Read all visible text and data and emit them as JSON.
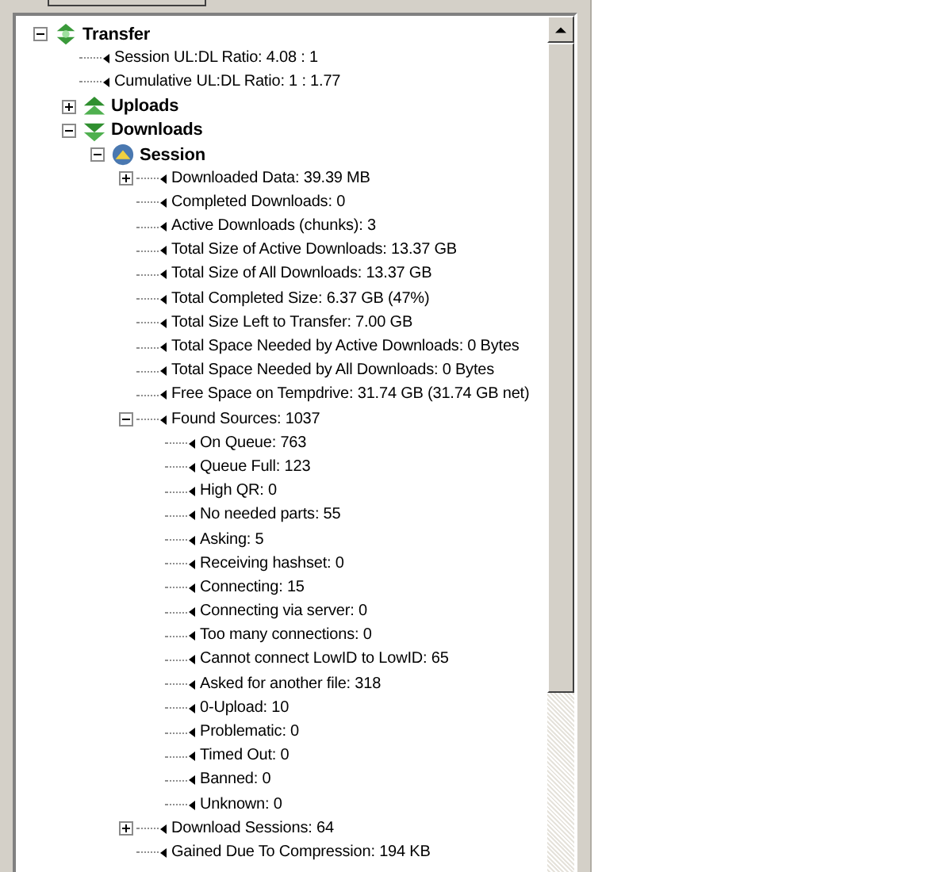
{
  "tree": [
    {
      "label": "Transfer",
      "kind": "transfer",
      "expanded": true,
      "children": [
        {
          "label": "Session UL:DL Ratio: 4.08 : 1",
          "kind": "stat"
        },
        {
          "label": "Cumulative UL:DL Ratio: 1 : 1.77",
          "kind": "stat"
        },
        {
          "label": "Uploads",
          "kind": "uploads",
          "expanded": false
        },
        {
          "label": "Downloads",
          "kind": "downloads",
          "expanded": true,
          "children": [
            {
              "label": "Session",
              "kind": "session",
              "expanded": true,
              "children": [
                {
                  "label": "Downloaded Data: 39.39 MB",
                  "kind": "stat",
                  "expanded": false
                },
                {
                  "label": "Completed Downloads: 0",
                  "kind": "stat"
                },
                {
                  "label": "Active Downloads (chunks): 3",
                  "kind": "stat"
                },
                {
                  "label": "Total Size of Active Downloads: 13.37 GB",
                  "kind": "stat"
                },
                {
                  "label": "Total Size of All Downloads: 13.37 GB",
                  "kind": "stat"
                },
                {
                  "label": "Total Completed Size: 6.37 GB (47%)",
                  "kind": "stat"
                },
                {
                  "label": "Total Size Left to Transfer: 7.00 GB",
                  "kind": "stat"
                },
                {
                  "label": "Total Space Needed by Active Downloads: 0 Bytes",
                  "kind": "stat"
                },
                {
                  "label": "Total Space Needed by All Downloads: 0 Bytes",
                  "kind": "stat"
                },
                {
                  "label": "Free Space on Tempdrive: 31.74 GB (31.74 GB net)",
                  "kind": "stat"
                },
                {
                  "label": "Found Sources: 1037",
                  "kind": "stat",
                  "expanded": true,
                  "children": [
                    {
                      "label": "On Queue: 763",
                      "kind": "stat"
                    },
                    {
                      "label": "Queue Full: 123",
                      "kind": "stat"
                    },
                    {
                      "label": "High QR: 0",
                      "kind": "stat"
                    },
                    {
                      "label": "No needed parts: 55",
                      "kind": "stat"
                    },
                    {
                      "label": "Asking: 5",
                      "kind": "stat"
                    },
                    {
                      "label": "Receiving hashset: 0",
                      "kind": "stat"
                    },
                    {
                      "label": "Connecting: 15",
                      "kind": "stat"
                    },
                    {
                      "label": "Connecting via server: 0",
                      "kind": "stat"
                    },
                    {
                      "label": "Too many connections: 0",
                      "kind": "stat"
                    },
                    {
                      "label": "Cannot connect LowID to LowID: 65",
                      "kind": "stat"
                    },
                    {
                      "label": "Asked for another file: 318",
                      "kind": "stat"
                    },
                    {
                      "label": "0-Upload: 10",
                      "kind": "stat"
                    },
                    {
                      "label": "Problematic: 0",
                      "kind": "stat"
                    },
                    {
                      "label": "Timed Out: 0",
                      "kind": "stat"
                    },
                    {
                      "label": "Banned: 0",
                      "kind": "stat"
                    },
                    {
                      "label": "Unknown: 0",
                      "kind": "stat"
                    }
                  ]
                },
                {
                  "label": "Download Sessions: 64",
                  "kind": "stat",
                  "expanded": false
                },
                {
                  "label": "Gained Due To Compression: 194 KB",
                  "kind": "stat"
                }
              ]
            }
          ]
        }
      ]
    }
  ]
}
